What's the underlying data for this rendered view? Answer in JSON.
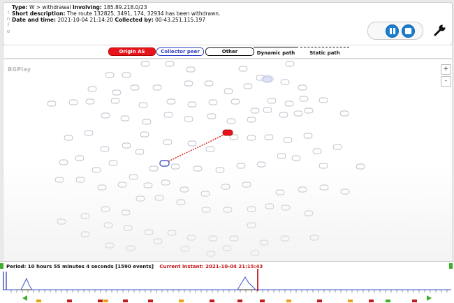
{
  "info": {
    "side_letters": [
      "I",
      "n",
      "f",
      "o"
    ],
    "type_label": "Type:",
    "type_value": "W > withdrawal",
    "involving_label": "Involving:",
    "involving_value": "185.89.218.0/23",
    "short_desc_label": "Short description:",
    "short_desc_value": "The route 132825, 3491, 174, 32934 has been withdrawn.",
    "datetime_label": "Date and time:",
    "datetime_value": "2021-10-04 21:14:20",
    "collected_label": "Collected by:",
    "collected_value": "00-43.251.115.197"
  },
  "controls": {
    "pause_icon": "pause-icon",
    "stop_icon": "stop-icon",
    "settings_icon": "wrench-icon",
    "accent_color": "#1c7fd0"
  },
  "legend": {
    "origin": "Origin AS",
    "peer": "Collector peer",
    "other": "Other",
    "dynamic": "Dynamic path",
    "static": "Static path",
    "origin_color": "#e8141b",
    "peer_color": "#2d3fbf"
  },
  "stage": {
    "brand": "BGPlay",
    "zoom_in": "+",
    "zoom_out": "-"
  },
  "timeline": {
    "period_text": "Period: 10 hours 55 minutes 4 seconds [1590 events]",
    "current_label": "Current instant:",
    "current_value": "2021-10-04 21:15:43"
  }
}
